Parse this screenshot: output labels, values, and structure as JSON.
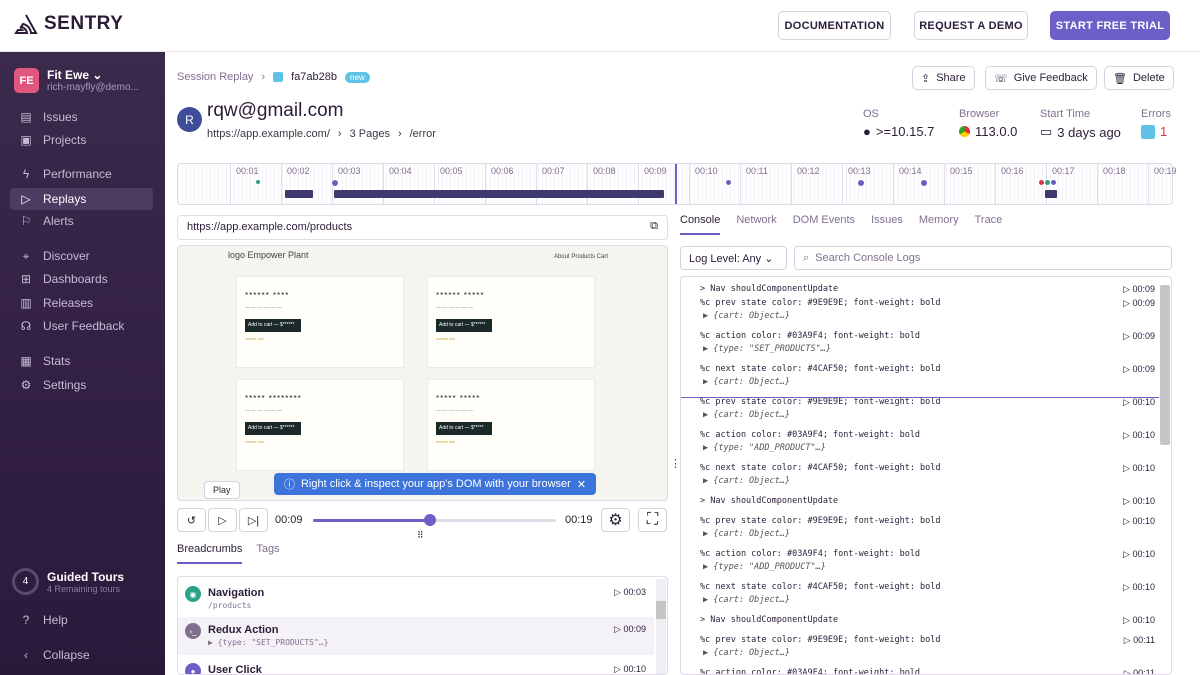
{
  "top": {
    "brand": "SENTRY",
    "docs": "DOCUMENTATION",
    "demo": "REQUEST A DEMO",
    "trial": "START FREE TRIAL"
  },
  "sidebar": {
    "org_initials": "FE",
    "org_name": "Fit Ewe",
    "org_user": "rich-mayfly@demo...",
    "items": [
      {
        "label": "Issues",
        "icon": "issues-icon"
      },
      {
        "label": "Projects",
        "icon": "projects-icon"
      },
      {
        "label": "Performance",
        "icon": "performance-icon"
      },
      {
        "label": "Replays",
        "icon": "play-icon"
      },
      {
        "label": "Alerts",
        "icon": "siren-icon"
      },
      {
        "label": "Discover",
        "icon": "telescope-icon"
      },
      {
        "label": "Dashboards",
        "icon": "dashboard-icon"
      },
      {
        "label": "Releases",
        "icon": "releases-icon"
      },
      {
        "label": "User Feedback",
        "icon": "feedback-icon"
      },
      {
        "label": "Stats",
        "icon": "stats-icon"
      },
      {
        "label": "Settings",
        "icon": "gear-icon"
      }
    ],
    "active": "Replays",
    "tours_count": "4",
    "tours_title": "Guided Tours",
    "tours_sub": "4 Remaining tours",
    "help": "Help",
    "collapse": "Collapse"
  },
  "header": {
    "crumb": "Session Replay",
    "replay_id": "fa7ab28b",
    "badge": "new",
    "share": "Share",
    "feedback": "Give Feedback",
    "delete": "Delete",
    "user_initial": "R",
    "email": "rqw@gmail.com",
    "url": "https://app.example.com/",
    "pages": "3 Pages",
    "path": "/error",
    "os_label": "OS",
    "os_value": ">=10.15.7",
    "browser_label": "Browser",
    "browser_value": "113.0.0",
    "start_label": "Start Time",
    "start_value": "3 days ago",
    "errors_label": "Errors",
    "errors_value": "1"
  },
  "timeline": {
    "ticks": [
      "00:01",
      "00:02",
      "00:03",
      "00:04",
      "00:05",
      "00:06",
      "00:07",
      "00:08",
      "00:09",
      "00:10",
      "00:11",
      "00:12",
      "00:13",
      "00:14",
      "00:15",
      "00:16",
      "00:17",
      "00:18",
      "00:19"
    ]
  },
  "player": {
    "url": "https://app.example.com/products",
    "site_logo": "logo Empower Plant",
    "site_nav": "About  Products  Cart",
    "cards": [
      {
        "title": "****** ****",
        "btn": "Add to cart — $******",
        "rating": "****** ***"
      },
      {
        "title": "****** *****",
        "btn": "Add to cart — $******",
        "rating": "****** ***"
      },
      {
        "title": "***** ********",
        "btn": "Add to cart — $******",
        "rating": "****** ***"
      },
      {
        "title": "***** *****",
        "btn": "Add to cart — $*****",
        "rating": "****** ***"
      }
    ],
    "tip": "Right click & inspect your app's DOM with your browser",
    "play_tooltip": "Play",
    "current": "00:09",
    "total": "00:19",
    "progress": 0.48
  },
  "left_tabs": [
    "Breadcrumbs",
    "Tags"
  ],
  "breadcrumbs": [
    {
      "title": "Navigation",
      "sub": "/products",
      "time": "00:03",
      "color": "#2ba185"
    },
    {
      "title": "Redux Action",
      "sub": "▶ {type: \"SET_PRODUCTS\"…}",
      "time": "00:09",
      "color": "#80708f"
    },
    {
      "title": "User Click",
      "sub": "",
      "time": "00:10",
      "color": "#6c5fc7"
    }
  ],
  "right_tabs": [
    "Console",
    "Network",
    "DOM Events",
    "Issues",
    "Memory",
    "Trace"
  ],
  "log_level": "Log Level: Any",
  "search_placeholder": "Search Console Logs",
  "console": [
    {
      "l1": "> Nav shouldComponentUpdate",
      "l2": "",
      "t": "00:09"
    },
    {
      "l1": "%c prev state color: #9E9E9E; font-weight: bold",
      "l2": "▶ {cart: Object…}",
      "t": "00:09"
    },
    {
      "l1": "%c action     color: #03A9F4; font-weight: bold",
      "l2": "▶ {type: \"SET_PRODUCTS\"…}",
      "t": "00:09"
    },
    {
      "l1": "%c next state color: #4CAF50; font-weight: bold",
      "l2": "▶ {cart: Object…}",
      "t": "00:09"
    },
    {
      "l1": "%c prev state color: #9E9E9E; font-weight: bold",
      "l2": "▶ {cart: Object…}",
      "t": "00:10"
    },
    {
      "l1": "%c action     color: #03A9F4; font-weight: bold",
      "l2": "▶ {type: \"ADD_PRODUCT\"…}",
      "t": "00:10"
    },
    {
      "l1": "%c next state color: #4CAF50; font-weight: bold",
      "l2": "▶ {cart: Object…}",
      "t": "00:10"
    },
    {
      "l1": "> Nav shouldComponentUpdate",
      "l2": "",
      "t": "00:10"
    },
    {
      "l1": "%c prev state color: #9E9E9E; font-weight: bold",
      "l2": "▶ {cart: Object…}",
      "t": "00:10"
    },
    {
      "l1": "%c action     color: #03A9F4; font-weight: bold",
      "l2": "▶ {type: \"ADD_PRODUCT\"…}",
      "t": "00:10"
    },
    {
      "l1": "%c next state color: #4CAF50; font-weight: bold",
      "l2": "▶ {cart: Object…}",
      "t": "00:10"
    },
    {
      "l1": "> Nav shouldComponentUpdate",
      "l2": "",
      "t": "00:10"
    },
    {
      "l1": "%c prev state color: #9E9E9E; font-weight: bold",
      "l2": "▶ {cart: Object…}",
      "t": "00:11"
    },
    {
      "l1": "%c action     color: #03A9F4; font-weight: bold",
      "l2": "",
      "t": "00:11"
    }
  ]
}
